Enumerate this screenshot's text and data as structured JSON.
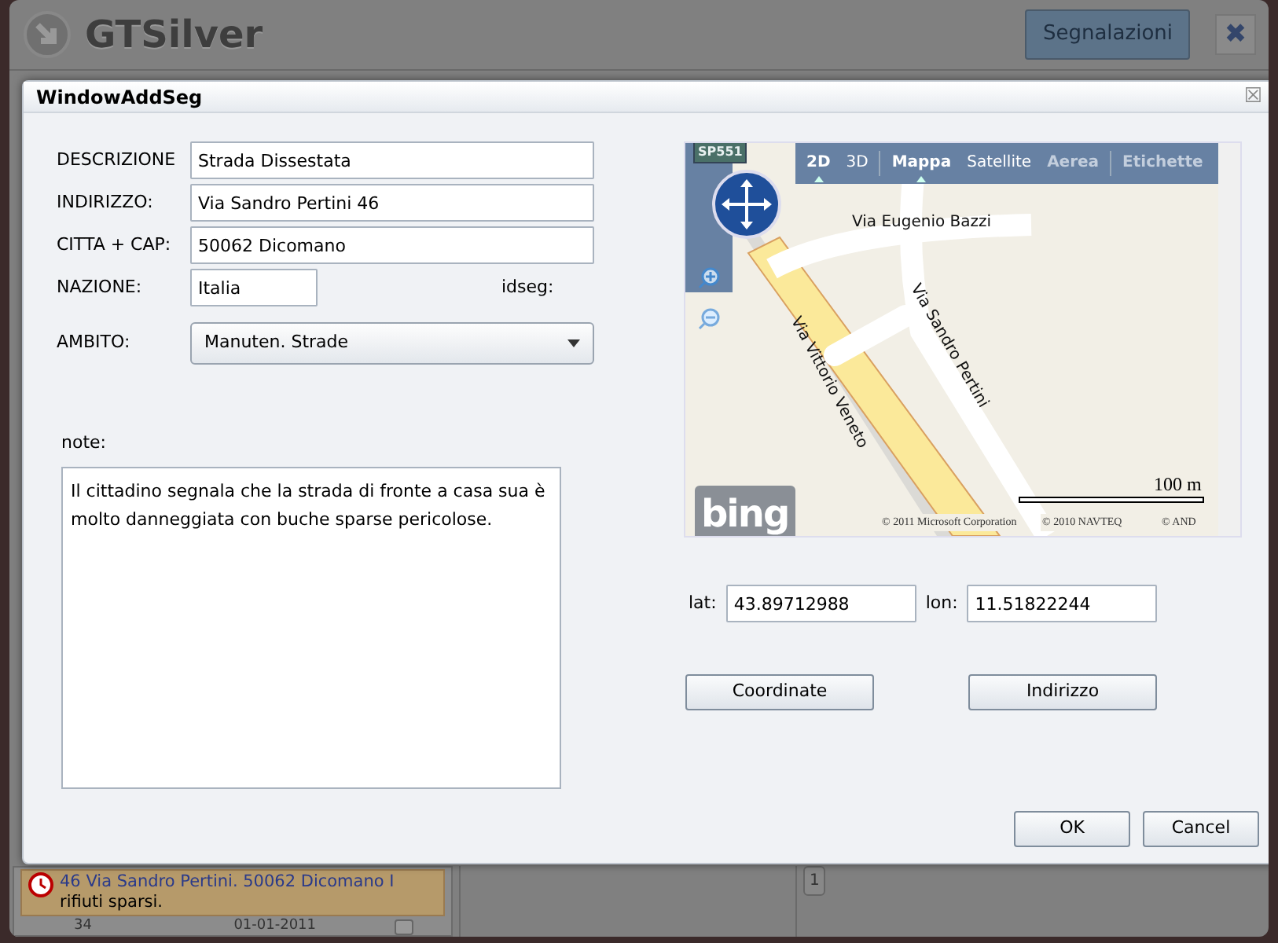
{
  "app": {
    "title": "GTSilver",
    "header_button": "Segnalazioni",
    "close": "✖"
  },
  "background_list": {
    "item": {
      "title": "46 Via Sandro Pertini. 50062 Dicomano I",
      "text": "rifiuti sparsi.",
      "id": "34",
      "date": "01-01-2011",
      "checked": false
    },
    "page": "1"
  },
  "dialog": {
    "title": "WindowAddSeg",
    "close": "☒",
    "fields": [
      {
        "label": "DESCRIZIONE",
        "value": "Strada Dissestata"
      },
      {
        "label": "INDIRIZZO:",
        "value": "Via Sandro Pertini 46"
      },
      {
        "label": "CITTA + CAP:",
        "value": "50062 Dicomano"
      },
      {
        "label": "NAZIONE:",
        "value": "Italia"
      }
    ],
    "idseg_label": "idseg:",
    "ambito": {
      "label": "AMBITO:",
      "value": "Manuten. Strade"
    },
    "note": {
      "label": "note:",
      "value": "Il cittadino segnala che la strada di fronte a casa sua è molto danneggiata con buche sparse pericolose."
    },
    "map": {
      "road_sign": "SP551",
      "view_modes": [
        {
          "label": "2D",
          "selected": true,
          "disabled": false
        },
        {
          "label": "3D",
          "selected": false,
          "disabled": false
        }
      ],
      "map_types": [
        {
          "label": "Mappa",
          "selected": true,
          "disabled": false
        },
        {
          "label": "Satellite",
          "selected": false,
          "disabled": false
        },
        {
          "label": "Aerea",
          "selected": false,
          "disabled": true
        }
      ],
      "labels_toggle": {
        "label": "Etichette",
        "disabled": true
      },
      "streets": [
        "Via Eugenio Bazzi",
        "Via Vittorio Veneto",
        "Via Sandro Pertini"
      ],
      "scale": "100 m",
      "logo": "bing",
      "credits": [
        "© 2011 Microsoft Corporation",
        "© 2010 NAVTEQ",
        "© AND"
      ]
    },
    "lat": {
      "label": "lat:",
      "value": "43.89712988"
    },
    "lon": {
      "label": "lon:",
      "value": "11.51822244"
    },
    "buttons": [
      "Coordinate",
      "Indirizzo"
    ],
    "footer_buttons": [
      "OK",
      "Cancel"
    ]
  }
}
